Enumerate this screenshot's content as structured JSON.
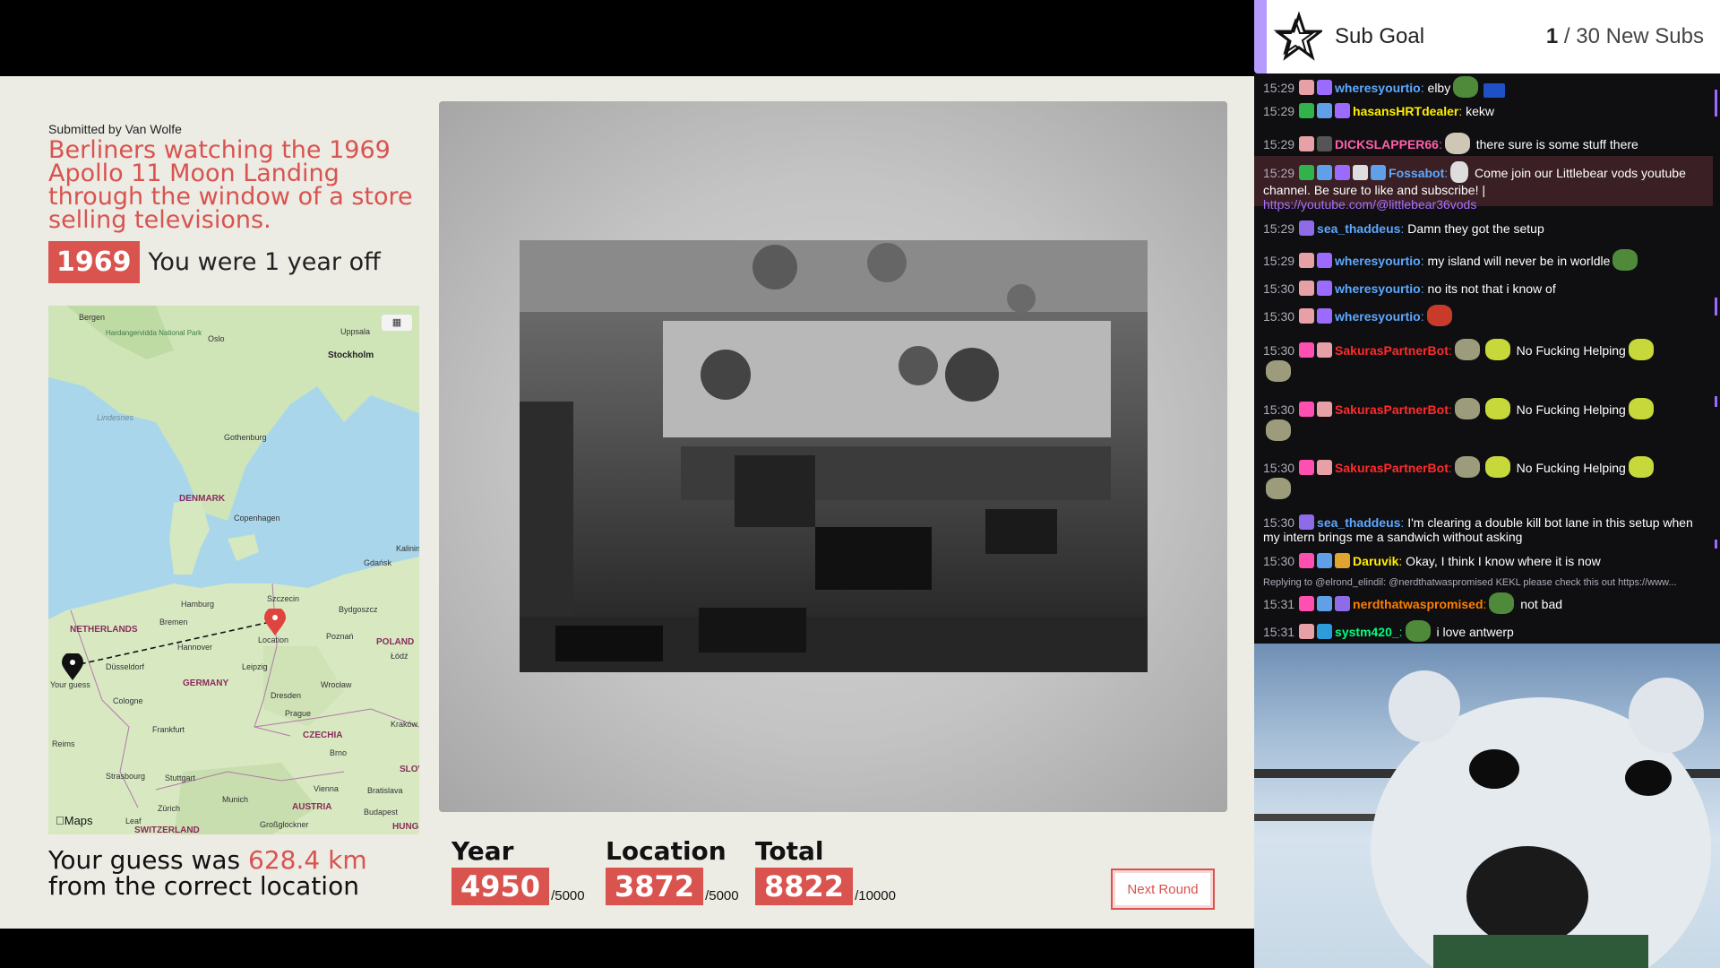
{
  "result": {
    "submitted_by": "Submitted by Van Wolfe",
    "title": "Berliners watching the 1969 Apollo 11 Moon Landing through the window of a store selling televisions.",
    "year": "1969",
    "year_off": "You were 1 year off"
  },
  "map": {
    "labels": {
      "bergen": "Bergen",
      "park": "Hardangervidda National Park",
      "oslo": "Oslo",
      "uppsala": "Uppsala",
      "stockholm": "Stockholm",
      "lindesnes": "Lindesnes",
      "gothenburg": "Gothenburg",
      "denmark": "DENMARK",
      "copenhagen": "Copenhagen",
      "kalinin": "Kalinin",
      "gdansk": "Gdańsk",
      "szczecin": "Szczecin",
      "bydgoszcz": "Bydgoszcz",
      "hamburg": "Hamburg",
      "bremen": "Bremen",
      "netherlands": "NETHERLANDS",
      "location": "Location",
      "poznan": "Poznań",
      "poland": "POLAND",
      "hannover": "Hannover",
      "lodz": "Łódź",
      "your_guess": "Your guess",
      "dusseldorf": "Düsseldorf",
      "leipzig": "Leipzig",
      "germany": "GERMANY",
      "wroclaw": "Wrocław",
      "cologne": "Cologne",
      "dresden": "Dresden",
      "prague": "Prague",
      "frankfurt": "Frankfurt",
      "czechia": "CZECHIA",
      "krakow": "Kraków",
      "reims": "Reims",
      "brno": "Brno",
      "strasbourg": "Strasbourg",
      "stuttgart": "Stuttgart",
      "vienna": "Vienna",
      "bratislava": "Bratislava",
      "munich": "Munich",
      "zurich": "Zürich",
      "austria": "AUSTRIA",
      "budapest": "Budapest",
      "switzerland": "SWITZERLAND",
      "grossglockner": "Großglockner",
      "slov": "SLOV",
      "hung": "HUNG",
      "leaf": "Leaf"
    },
    "maps_logo": "Maps"
  },
  "distance": {
    "prefix": "Your guess was ",
    "km": "628.4 km",
    "suffix": "from the correct location"
  },
  "scores": {
    "year": {
      "label": "Year",
      "value": "4950",
      "max": "/5000"
    },
    "location": {
      "label": "Location",
      "value": "3872",
      "max": "/5000"
    },
    "total": {
      "label": "Total",
      "value": "8822",
      "max": "/10000"
    }
  },
  "next_round": "Next Round",
  "sub_goal": {
    "title": "Sub Goal",
    "current": "1",
    "target": "/ 30 New Subs"
  },
  "chat": [
    {
      "time": "15:29",
      "user": "wheresyourtio",
      "color": "#5da9ff",
      "text": " elby"
    },
    {
      "time": "15:29",
      "user": "hasansHRTdealer",
      "color": "#ffef00",
      "text": " kekw"
    },
    {
      "time": "15:29",
      "user": "DICKSLAPPER66",
      "color": "#ff5fa8",
      "text": " there sure is some stuff there"
    },
    {
      "time": "15:29",
      "user": "Fossabot",
      "color": "#5da9ff",
      "text": " Come join our Littlebear vods youtube channel. Be sure to like and subscribe! | ",
      "link": "https://youtube.com/@littlebear36vods"
    },
    {
      "time": "15:29",
      "user": "sea_thaddeus",
      "color": "#5da9ff",
      "text": " Damn they got the setup"
    },
    {
      "time": "15:29",
      "user": "wheresyourtio",
      "color": "#5da9ff",
      "text": " my island will never be in worldle"
    },
    {
      "time": "15:30",
      "user": "wheresyourtio",
      "color": "#5da9ff",
      "text": " no its not that i know of"
    },
    {
      "time": "15:30",
      "user": "wheresyourtio",
      "color": "#5da9ff",
      "text": ""
    },
    {
      "time": "15:30",
      "user": "SakurasPartnerBot",
      "color": "#ff2b2b",
      "text": " No Fucking Helping"
    },
    {
      "time": "15:30",
      "user": "SakurasPartnerBot",
      "color": "#ff2b2b",
      "text": " No Fucking Helping"
    },
    {
      "time": "15:30",
      "user": "SakurasPartnerBot",
      "color": "#ff2b2b",
      "text": " No Fucking Helping"
    },
    {
      "time": "15:30",
      "user": "sea_thaddeus",
      "color": "#5da9ff",
      "text": " I'm clearing a double kill bot lane in this setup when my intern brings me a sandwich without asking"
    },
    {
      "time": "15:30",
      "user": "Daruvik",
      "color": "#ffef00",
      "text": " Okay, I think I know where it is now"
    },
    {
      "reply": "Replying to @elrond_elindil: @nerdthatwaspromised KEKL please check this out https://www..."
    },
    {
      "time": "15:31",
      "user": "nerdthatwaspromised",
      "color": "#ff7f00",
      "text": " not bad"
    },
    {
      "time": "15:31",
      "user": "systm420_",
      "color": "#00ff7f",
      "text": " i love antwerp"
    }
  ]
}
